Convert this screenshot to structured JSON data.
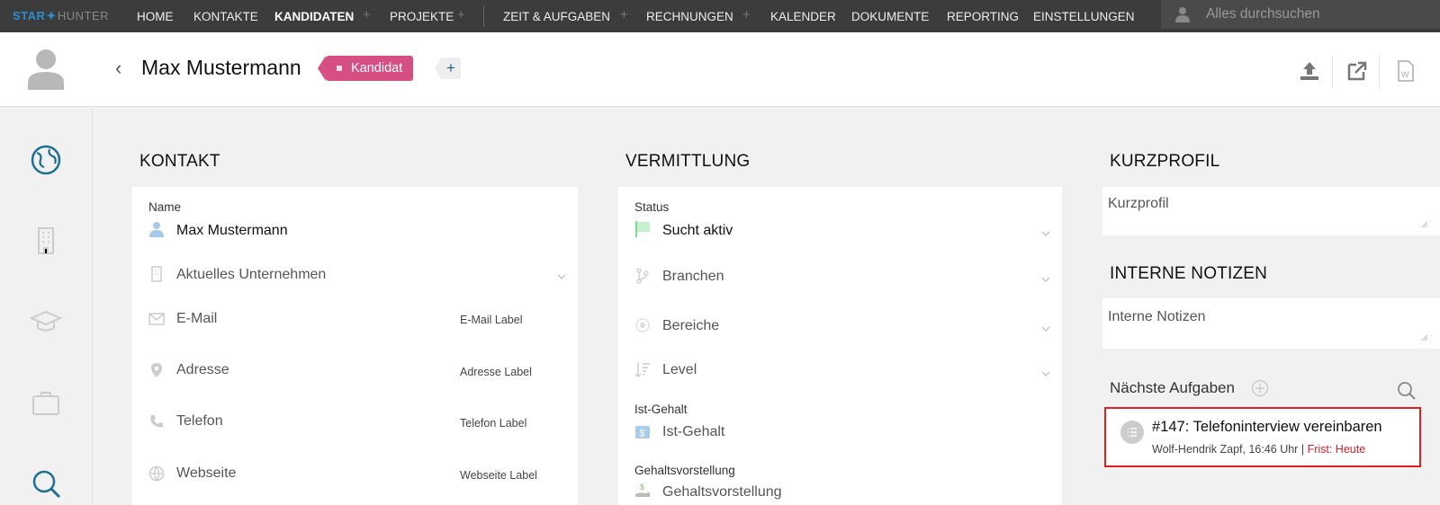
{
  "brand": {
    "part1": "STAR",
    "part2": "HUNTER"
  },
  "nav": {
    "home": "HOME",
    "kontakte": "KONTAKTE",
    "kandidaten": "KANDIDATEN",
    "projekte": "PROJEKTE",
    "zeit": "ZEIT & AUFGABEN",
    "rechnungen": "RECHNUNGEN",
    "kalender": "KALENDER",
    "dokumente": "DOKUMENTE",
    "reporting": "REPORTING",
    "einstellungen": "EINSTELLUNGEN",
    "plus": "+"
  },
  "search": {
    "placeholder": "Alles durchsuchen"
  },
  "header": {
    "name": "Max Mustermann",
    "tag": "Kandidat",
    "add": "+"
  },
  "kontakt": {
    "title": "KONTAKT",
    "name_label": "Name",
    "name_value": "Max Mustermann",
    "company": "Aktuelles Unternehmen",
    "email": "E-Mail",
    "email_label": "E-Mail Label",
    "address": "Adresse",
    "address_label": "Adresse Label",
    "phone": "Telefon",
    "phone_label": "Telefon Label",
    "website": "Webseite",
    "website_label": "Webseite Label"
  },
  "vermittlung": {
    "title": "VERMITTLUNG",
    "status_label": "Status",
    "status_value": "Sucht aktiv",
    "branchen": "Branchen",
    "bereiche": "Bereiche",
    "level": "Level",
    "ist_label": "Ist-Gehalt",
    "ist_value": "Ist-Gehalt",
    "soll_label": "Gehaltsvorstellung",
    "soll_value": "Gehaltsvorstellung"
  },
  "kurzprofil": {
    "title": "KURZPROFIL",
    "placeholder": "Kurzprofil"
  },
  "notizen": {
    "title": "INTERNE NOTIZEN",
    "placeholder": "Interne Notizen"
  },
  "aufgaben": {
    "title": "Nächste Aufgaben",
    "task_title": "#147: Telefoninterview vereinbaren",
    "task_meta": "Wolf-Hendrik Zapf, 16:46 Uhr",
    "task_sep": "|",
    "task_due": "Frist: Heute"
  },
  "colors": {
    "accent": "#2d8fd0",
    "tag": "#d64f84",
    "highlight": "#e02020",
    "status": "#8ee6a0"
  }
}
